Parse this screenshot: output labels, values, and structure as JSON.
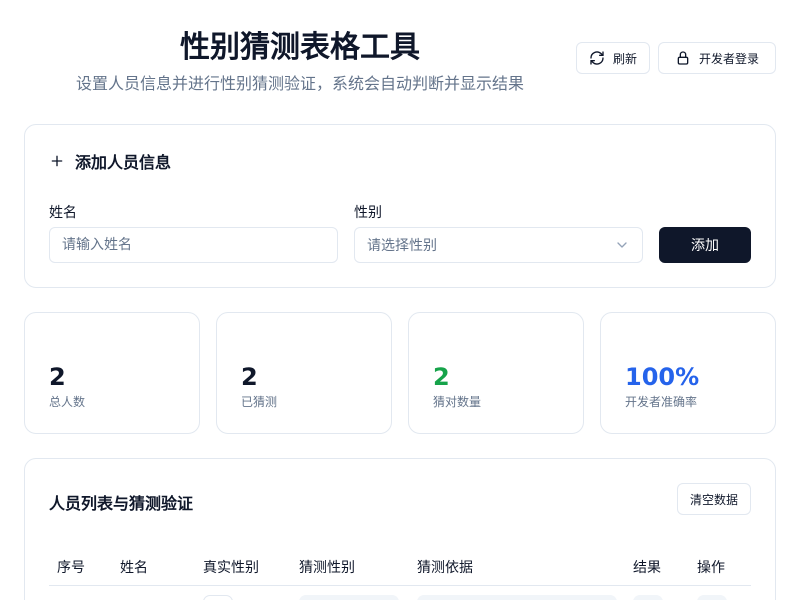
{
  "header": {
    "title": "性别猜测表格工具",
    "subtitle": "设置人员信息并进行性别猜测验证，系统会自动判断并显示结果",
    "refresh_label": "刷新",
    "login_label": "开发者登录"
  },
  "add_form": {
    "title": "添加人员信息",
    "name_label": "姓名",
    "name_placeholder": "请输入姓名",
    "gender_label": "性别",
    "gender_placeholder": "请选择性别",
    "add_button": "添加"
  },
  "stats": [
    {
      "value": "2",
      "label": "总人数",
      "color": "#0f172a"
    },
    {
      "value": "2",
      "label": "已猜测",
      "color": "#0f172a"
    },
    {
      "value": "2",
      "label": "猜对数量",
      "color": "#16a34a"
    },
    {
      "value": "100%",
      "label": "开发者准确率",
      "color": "#2563eb"
    }
  ],
  "list": {
    "title": "人员列表与猜测验证",
    "clear_button": "清空数据",
    "columns": [
      "序号",
      "姓名",
      "真实性别",
      "猜测性别",
      "猜测依据",
      "结果",
      "操作"
    ]
  },
  "colors": {
    "primary": "#0f172a",
    "border": "#e2e8f0",
    "muted": "#64748b",
    "success": "#16a34a",
    "accent": "#2563eb"
  }
}
